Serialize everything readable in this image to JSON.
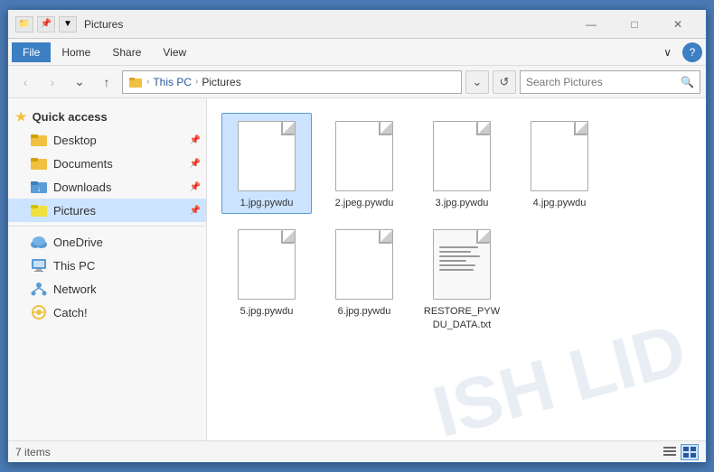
{
  "window": {
    "title": "Pictures",
    "title_full": "Pictures",
    "minimize_label": "—",
    "maximize_label": "□",
    "close_label": "✕"
  },
  "menu": {
    "items": [
      {
        "id": "file",
        "label": "File",
        "active": true
      },
      {
        "id": "home",
        "label": "Home",
        "active": false
      },
      {
        "id": "share",
        "label": "Share",
        "active": false
      },
      {
        "id": "view",
        "label": "View",
        "active": false
      }
    ],
    "chevron_label": "∨",
    "help_label": "?"
  },
  "address_bar": {
    "back_label": "‹",
    "forward_label": "›",
    "up_label": "↑",
    "refresh_label": "⟳",
    "path": {
      "separator": "›",
      "segments": [
        "This PC",
        "Pictures"
      ],
      "current": "Pictures"
    },
    "search_placeholder": "Search Pictures",
    "search_icon": "🔍"
  },
  "sidebar": {
    "quick_access_label": "Quick access",
    "items": [
      {
        "id": "desktop",
        "label": "Desktop",
        "icon": "folder",
        "pinned": true
      },
      {
        "id": "documents",
        "label": "Documents",
        "icon": "folder",
        "pinned": true
      },
      {
        "id": "downloads",
        "label": "Downloads",
        "icon": "folder-down",
        "pinned": true
      },
      {
        "id": "pictures",
        "label": "Pictures",
        "icon": "folder-pic",
        "pinned": true,
        "active": true
      },
      {
        "id": "onedrive",
        "label": "OneDrive",
        "icon": "cloud"
      },
      {
        "id": "thispc",
        "label": "This PC",
        "icon": "pc"
      },
      {
        "id": "network",
        "label": "Network",
        "icon": "network"
      },
      {
        "id": "catch",
        "label": "Catch!",
        "icon": "catch"
      }
    ]
  },
  "files": {
    "items": [
      {
        "id": "f1",
        "name": "1.jpg.pywdu",
        "type": "file",
        "selected": true
      },
      {
        "id": "f2",
        "name": "2.jpeg.pywdu",
        "type": "file",
        "selected": false
      },
      {
        "id": "f3",
        "name": "3.jpg.pywdu",
        "type": "file",
        "selected": false
      },
      {
        "id": "f4",
        "name": "4.jpg.pywdu",
        "type": "file",
        "selected": false
      },
      {
        "id": "f5",
        "name": "5.jpg.pywdu",
        "type": "file",
        "selected": false
      },
      {
        "id": "f6",
        "name": "6.jpg.pywdu",
        "type": "file",
        "selected": false
      },
      {
        "id": "f7",
        "name": "RESTORE_PYWDU_DATA.txt",
        "type": "txt",
        "selected": false
      }
    ]
  },
  "status_bar": {
    "count": "7",
    "label": "items"
  },
  "watermark": {
    "text": "ISH LID"
  }
}
